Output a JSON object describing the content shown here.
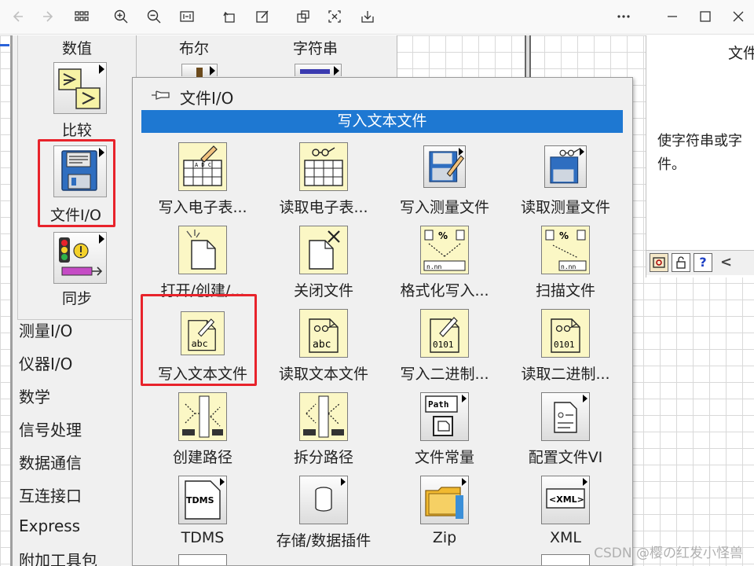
{
  "toolbar": {
    "icons": [
      "back-icon",
      "forward-icon",
      "grid-icon",
      "zoom-in-icon",
      "zoom-out-icon",
      "fit-width-icon",
      "rotate-icon",
      "edit-icon",
      "crop-icon",
      "scan-icon",
      "download-icon",
      "more-icon",
      "minimize-icon",
      "maximize-icon",
      "close-icon"
    ]
  },
  "palette": {
    "col_headers": [
      "数值",
      "布尔",
      "字符串"
    ],
    "categories": [
      {
        "label": "比较"
      },
      {
        "label": "文件I/O"
      },
      {
        "label": "同步"
      }
    ],
    "side_items": [
      "测量I/O",
      "仪器I/O",
      "数学",
      "信号处理",
      "数据通信",
      "互连接口",
      "Express",
      "附加工具包"
    ]
  },
  "submenu": {
    "title": "文件I/O",
    "selected_label": "写入文本文件",
    "items": [
      {
        "label": "写入电子表..."
      },
      {
        "label": "读取电子表..."
      },
      {
        "label": "写入测量文件"
      },
      {
        "label": "读取测量文件"
      },
      {
        "label": "打开/创建/..."
      },
      {
        "label": "关闭文件"
      },
      {
        "label": "格式化写入..."
      },
      {
        "label": "扫描文件"
      },
      {
        "label": "写入文本文件"
      },
      {
        "label": "读取文本文件"
      },
      {
        "label": "写入二进制..."
      },
      {
        "label": "读取二进制..."
      },
      {
        "label": "创建路径"
      },
      {
        "label": "拆分路径"
      },
      {
        "label": "文件常量"
      },
      {
        "label": "配置文件VI"
      },
      {
        "label": "TDMS"
      },
      {
        "label": "存储/数据插件"
      },
      {
        "label": "Zip"
      },
      {
        "label": "XML"
      }
    ],
    "icon_text": {
      "abc": "abc",
      "bin": "0101",
      "path": "Path",
      "tdms": "TDMS",
      "xml": "<XML>"
    }
  },
  "help": {
    "title": "文件",
    "text_line1": "使字符串或字",
    "text_line2": "件。",
    "scroll_left": "<"
  },
  "watermark": "CSDN @樱の红发小怪兽"
}
